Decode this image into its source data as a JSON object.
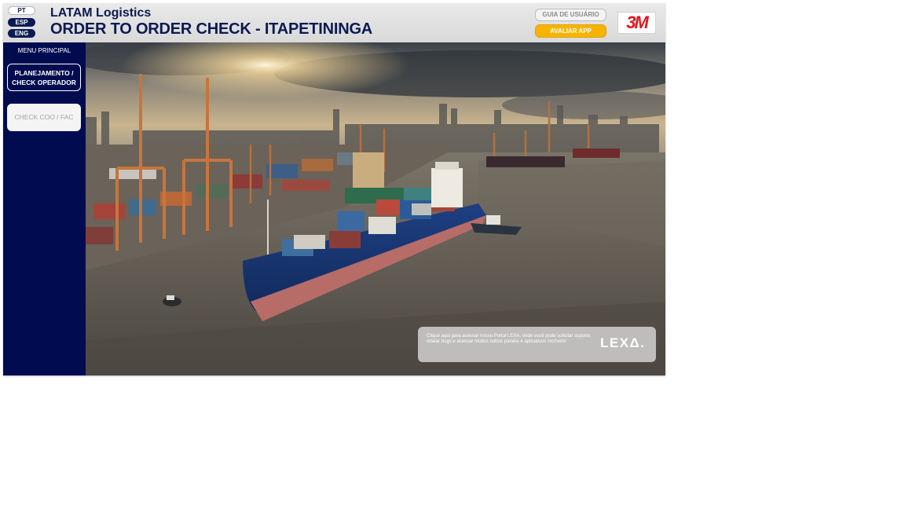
{
  "languages": {
    "pt": "PT",
    "esp": "ESP",
    "eng": "ENG"
  },
  "header": {
    "brand": "LATAM Logistics",
    "title": "ORDER TO ORDER CHECK - ITAPETININGA",
    "guide_button": "GUIA DE USUÁRIO",
    "rate_button": "AVALIAR APP",
    "logo_text": "3M"
  },
  "sidebar": {
    "menu_title": "MENU PRINCIPAL",
    "items": [
      {
        "label": "PLANEJAMENTO / CHECK OPERADOR"
      },
      {
        "label": "CHECK COO / FAC"
      }
    ]
  },
  "hero": {
    "image": "port-container-ship-photo",
    "lexa_card": {
      "text": "Clique aqui para acessar nosso Portal LEXA, onde você pode solicitar suporte, relatar bugs e acessar muitos outros painéis e aplicativos incríveis!",
      "logo": "LEXΔ."
    }
  },
  "colors": {
    "navy": "#000c4f",
    "title_navy": "#0b1a52",
    "accent_yellow": "#f6b400",
    "brand_red": "#e4161f"
  }
}
